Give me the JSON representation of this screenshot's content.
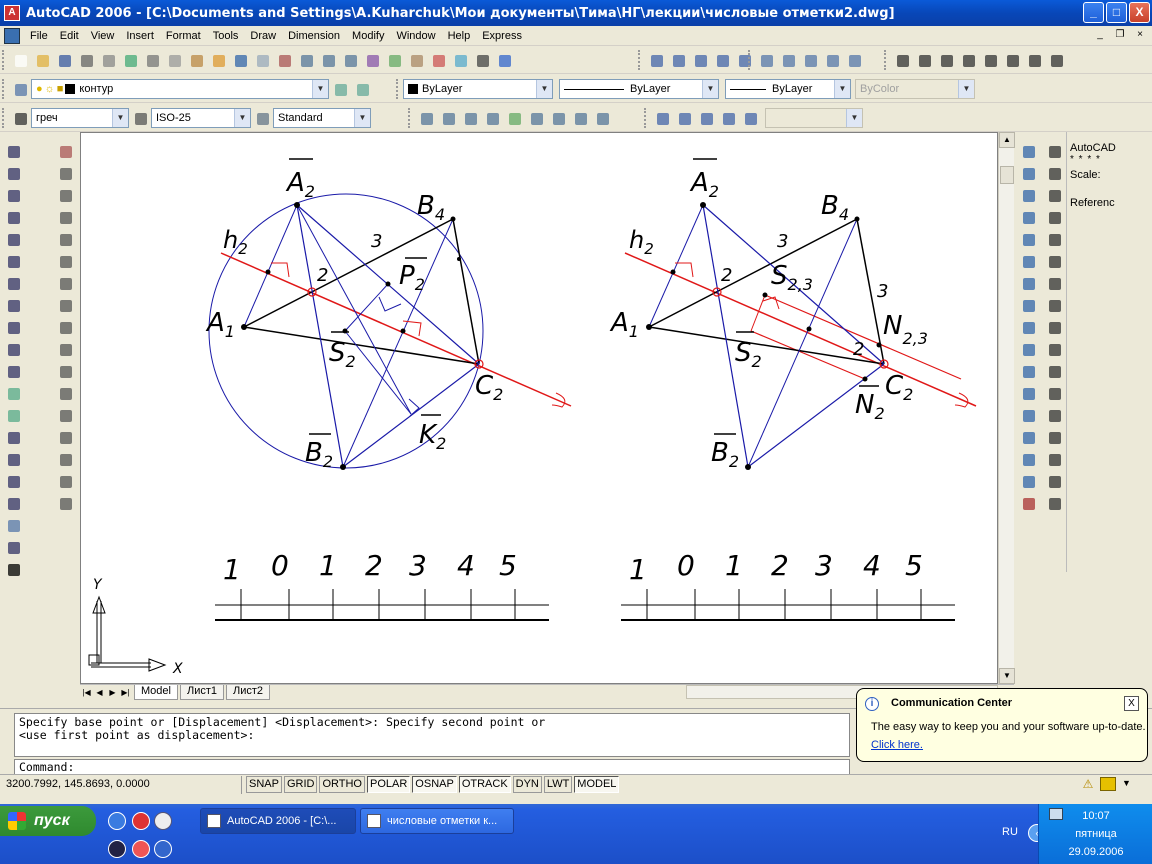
{
  "window": {
    "title": "AutoCAD 2006 - [C:\\Documents and Settings\\A.Kuharchuk\\Мои документы\\Тима\\НГ\\лекции\\числовые отметки2.dwg]",
    "app_icon": "A",
    "min": "_",
    "max": "□",
    "close": "X"
  },
  "menu": [
    "File",
    "Edit",
    "View",
    "Insert",
    "Format",
    "Tools",
    "Draw",
    "Dimension",
    "Modify",
    "Window",
    "Help",
    "Express"
  ],
  "mdi": {
    "min": "_",
    "restore": "❐",
    "close": "×"
  },
  "layers": {
    "layer_name": "контур",
    "color": "ByLayer",
    "linetype": "ByLayer",
    "lineweight": "ByLayer",
    "plotstyle": "ByColor"
  },
  "styles": {
    "text_style": "греч",
    "dim_style": "ISO-25",
    "table_style": "Standard"
  },
  "properties_palette": {
    "title": "AutoCAD",
    "stars": "* * * *",
    "scale_label": "Scale:",
    "reference_label": "Referenc"
  },
  "drawing": {
    "left": {
      "h2": "h",
      "h_sub": "2",
      "A2": "A",
      "A2_sub": "2",
      "B4": "B",
      "B4_sub": "4",
      "A1": "A",
      "A1_sub": "1",
      "P2": "P",
      "P2_sub": "2",
      "S2": "S",
      "S2_sub": "2",
      "C2": "C",
      "C2_sub": "2",
      "B2": "B",
      "B2_sub": "2",
      "K2": "K",
      "K2_sub": "2",
      "n3": "3",
      "n2": "2"
    },
    "right": {
      "h2": "h",
      "h_sub": "2",
      "A2": "A",
      "A2_sub": "2",
      "B4": "B",
      "B4_sub": "4",
      "A1": "A",
      "A1_sub": "1",
      "S23": "S",
      "S23_sub": "2,3",
      "N23": "N",
      "N23_sub": "2,3",
      "S2": "S",
      "S2_sub": "2",
      "C2": "C",
      "C2_sub": "2",
      "N2": "N",
      "N2_sub": "2",
      "B2": "B",
      "B2_sub": "2",
      "n3a": "3",
      "n2a": "2",
      "n3b": "3",
      "n2b": "2"
    },
    "scale_labels": [
      "1",
      "0",
      "1",
      "2",
      "3",
      "4",
      "5"
    ],
    "ucs_x": "X",
    "ucs_y": "Y"
  },
  "tabs": [
    "Model",
    "Лист1",
    "Лист2"
  ],
  "command": {
    "history_line1": "Specify base point or [Displacement] <Displacement>: Specify second point or",
    "history_line2": "<use first point as displacement>:",
    "prompt": "Command:"
  },
  "status": {
    "coords": "3200.7992, 145.8693, 0.0000",
    "buttons": [
      "SNAP",
      "GRID",
      "ORTHO",
      "POLAR",
      "OSNAP",
      "OTRACK",
      "DYN",
      "LWT",
      "MODEL"
    ]
  },
  "balloon": {
    "icon": "i",
    "title": "Communication Center",
    "text": "The easy way to keep you and your software up-to-date.",
    "link": "Click here.",
    "close": "X"
  },
  "taskbar": {
    "start": "пуск",
    "tasks": [
      "AutoCAD 2006 - [C:\\...",
      "числовые отметки к..."
    ],
    "lang": "RU",
    "time": "10:07",
    "day": "пятница",
    "date": "29.09.2006"
  },
  "colors": {
    "blue_line": "#1a1aa8",
    "red_line": "#e01818",
    "black_line": "#000000",
    "circle": "#1a1aa8"
  }
}
